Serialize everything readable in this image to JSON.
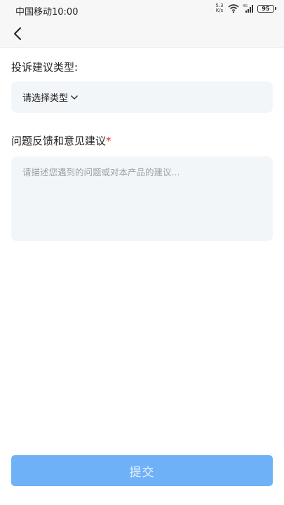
{
  "status_bar": {
    "carrier_time": "中国移动10:00",
    "net_speed_top": "5.3",
    "net_speed_bottom": "K/s",
    "network_type": "4G",
    "battery": "95"
  },
  "nav": {
    "back_icon": "chevron-left-icon"
  },
  "form": {
    "type_label": "投诉建议类型:",
    "type_select_value": "请选择类型",
    "feedback_label": "问题反馈和意见建议",
    "required_mark": "*",
    "feedback_placeholder": "请描述您遇到的问题或对本产品的建议...",
    "submit_label": "提交"
  },
  "colors": {
    "accent": "#6fb1f7",
    "required": "#e0322f",
    "field_bg": "#f3f6f9"
  }
}
